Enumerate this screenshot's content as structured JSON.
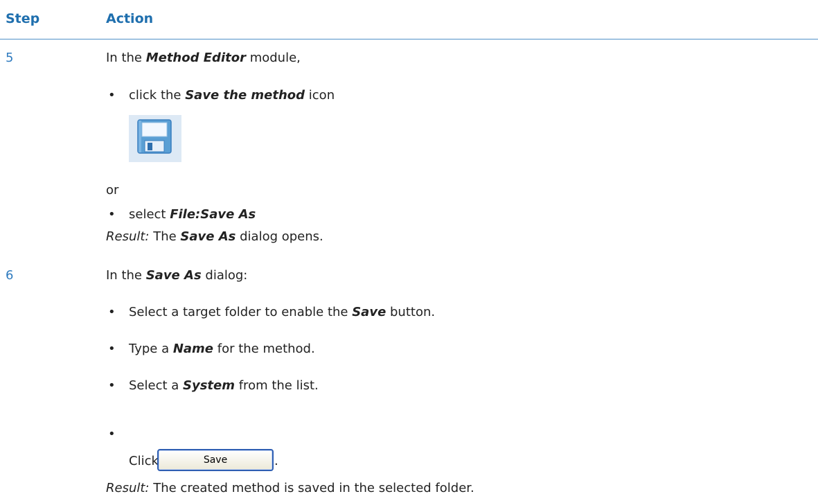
{
  "header": {
    "step": "Step",
    "action": "Action"
  },
  "steps": [
    {
      "number": "5",
      "intro": {
        "pre": "In the ",
        "bold": "Method Editor",
        "post": " module,"
      },
      "bullet1": {
        "pre": "click the ",
        "bold": "Save the method",
        "post": " icon"
      },
      "icon": "floppy-disk-save-icon",
      "or": "or",
      "bullet2": {
        "pre": "select ",
        "bold": "File:Save As"
      },
      "result": {
        "label": "Result:",
        "pre": " The ",
        "bold": "Save As",
        "post": " dialog opens."
      }
    },
    {
      "number": "6",
      "intro": {
        "pre": "In the ",
        "bold": "Save As",
        "post": " dialog:"
      },
      "bullets": [
        {
          "pre": "Select a target folder to enable the ",
          "bold": "Save",
          "post": " button."
        },
        {
          "pre": "Type a ",
          "bold": "Name",
          "post": " for the method."
        },
        {
          "pre": "Select a ",
          "bold": "System",
          "post": " from the list."
        }
      ],
      "click": {
        "pre": "Click ",
        "button": "Save",
        "post": "."
      },
      "result": {
        "label": "Result:",
        "text": " The created method is saved in the selected folder."
      }
    }
  ],
  "colors": {
    "heading": "#1f6fae",
    "step_number": "#2f7bbf",
    "rule": "#4f90c8"
  }
}
